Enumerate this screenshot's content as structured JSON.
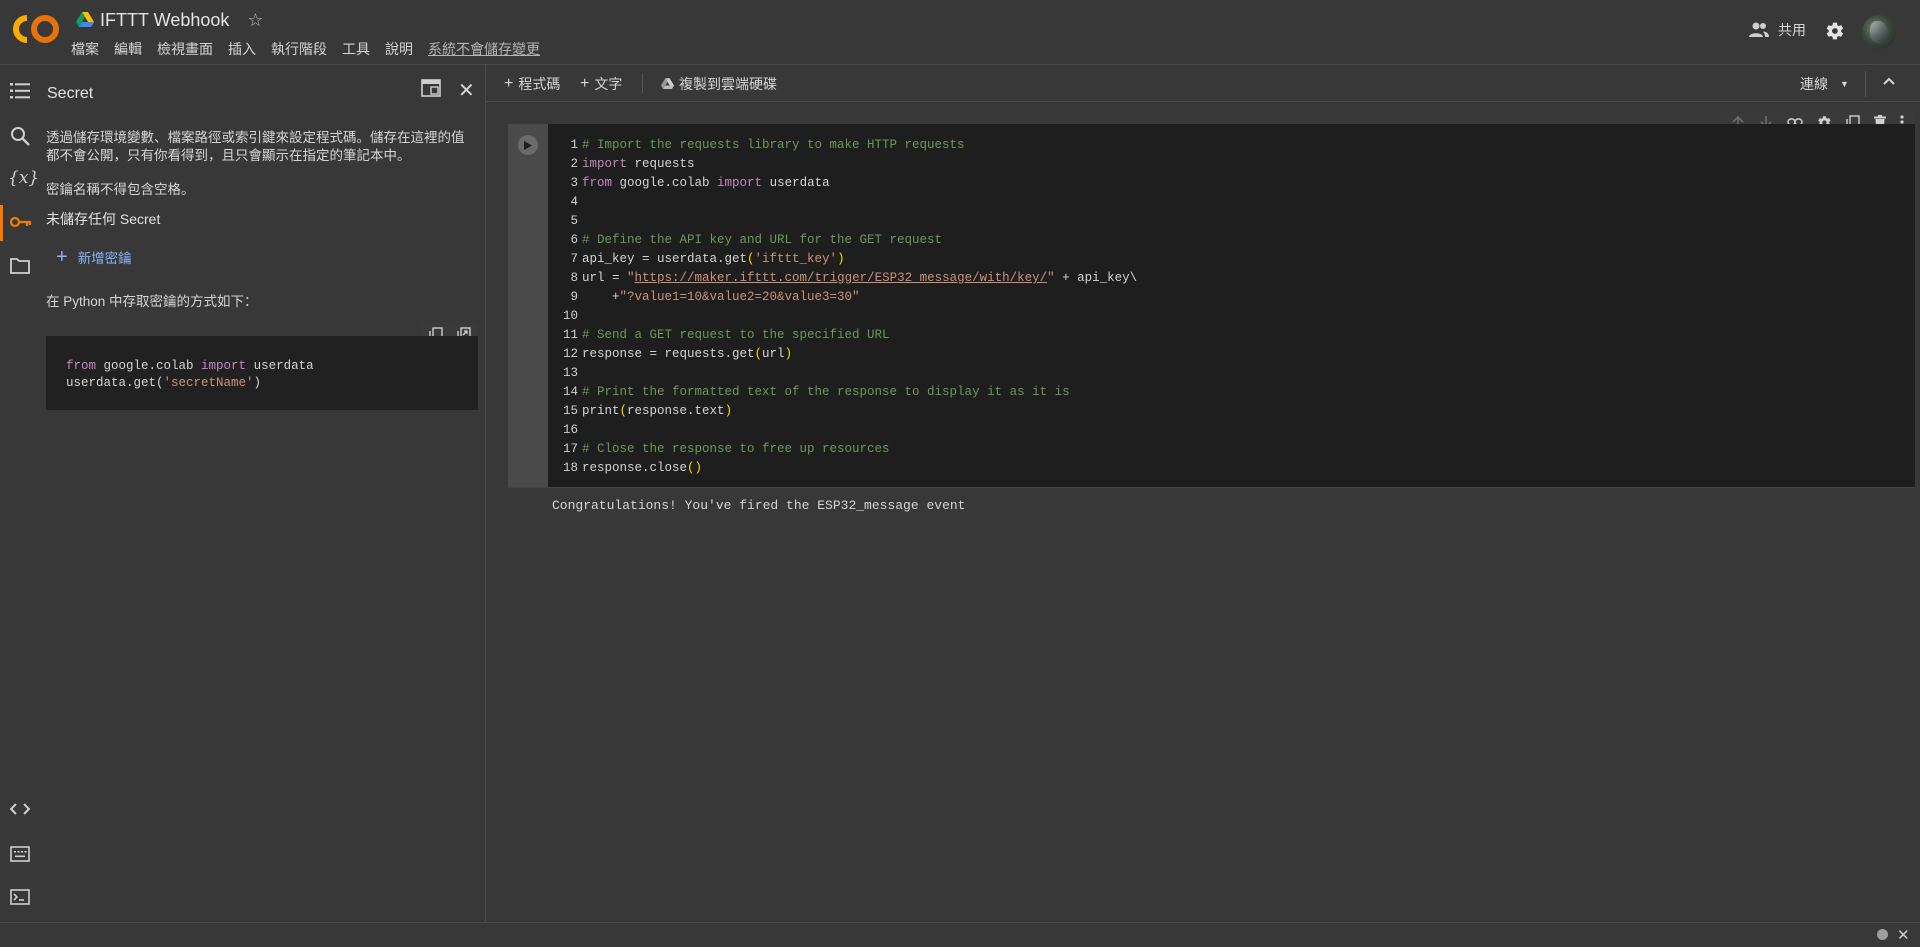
{
  "header": {
    "title": "IFTTT Webhook",
    "menu": [
      "檔案",
      "編輯",
      "檢視畫面",
      "插入",
      "執行階段",
      "工具",
      "說明"
    ],
    "unsaved_notice": "系統不會儲存變更",
    "share_label": "共用"
  },
  "secret_panel": {
    "title": "Secret",
    "description": "透過儲存環境變數、檔案路徑或索引鍵來設定程式碼。儲存在這裡的值都不會公開，只有你看得到，且只會顯示在指定的筆記本中。",
    "name_rule": "密鑰名稱不得包含空格。",
    "empty_state": "未儲存任何 Secret",
    "add_secret_label": "新增密鑰",
    "python_howto": "在 Python 中存取密鑰的方式如下：",
    "snippet": {
      "line1": {
        "kw_from": "from",
        "module": " google.colab ",
        "kw_import": "import",
        "name": " userdata"
      },
      "line2": {
        "prefix": "userdata.get",
        "open": "(",
        "arg": "'secretName'",
        "close": ")"
      }
    }
  },
  "toolbar": {
    "add_code": "程式碼",
    "add_text": "文字",
    "copy_to_drive": "複製到雲端硬碟",
    "connect": "連線"
  },
  "cell": {
    "line_numbers": [
      "1",
      "2",
      "3",
      "4",
      "5",
      "6",
      "7",
      "8",
      "9",
      "10",
      "11",
      "12",
      "13",
      "14",
      "15",
      "16",
      "17",
      "18"
    ],
    "lines": {
      "l1": "# Import the requests library to make HTTP requests",
      "l2_kw": "import",
      "l2_rest": " requests",
      "l3_kw1": "from",
      "l3_mod": " google.colab ",
      "l3_kw2": "import",
      "l3_rest": " userdata",
      "l6": "# Define the API key and URL for the GET request",
      "l7_a": "api_key = userdata.get",
      "l7_p1": "(",
      "l7_str": "'ifttt_key'",
      "l7_p2": ")",
      "l8_a": "url = ",
      "l8_q1": "\"",
      "l8_url": "https://maker.ifttt.com/trigger/ESP32_message/with/key/",
      "l8_q2": "\"",
      "l8_b": " + api_key\\",
      "l9_a": "    +",
      "l9_str": "\"?value1=10&value2=20&value3=30\"",
      "l11": "# Send a GET request to the specified URL",
      "l12_a": "response = requests.get",
      "l12_p1": "(",
      "l12_arg": "url",
      "l12_p2": ")",
      "l14": "# Print the formatted text of the response to display it as it is",
      "l15_a": "print",
      "l15_p1": "(",
      "l15_arg": "response.text",
      "l15_p2": ")",
      "l17": "# Close the response to free up resources",
      "l18_a": "response.close",
      "l18_p": "()"
    },
    "output": "Congratulations! You've fired the ESP32_message event"
  },
  "colors": {
    "accent_orange": "#f57c00",
    "link_blue": "#8ab4f8",
    "background": "#383838",
    "editor_bg": "#1e1e1e"
  }
}
